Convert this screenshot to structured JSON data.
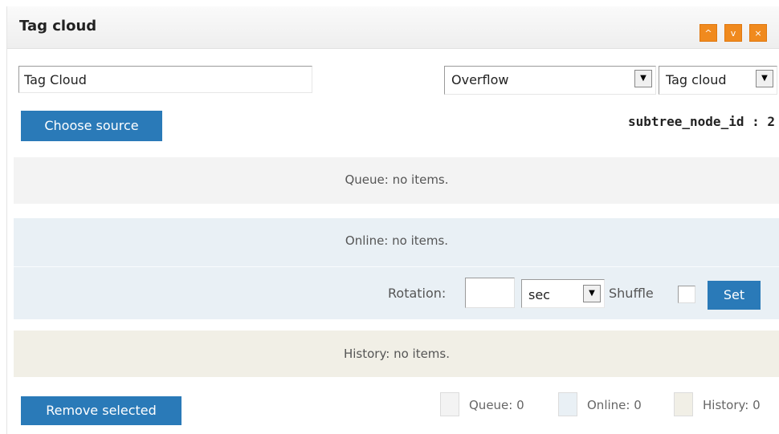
{
  "header": {
    "title": "Tag cloud",
    "buttons": [
      {
        "icon": "chevron-up-icon",
        "glyph": "^"
      },
      {
        "icon": "chevron-down-icon",
        "glyph": "v"
      },
      {
        "icon": "close-icon",
        "glyph": "×"
      }
    ],
    "button_color": "#f08a1e"
  },
  "form": {
    "name_value": "Tag Cloud",
    "overflow_select": "Overflow",
    "view_select": "Tag cloud",
    "choose_source_label": "Choose source",
    "subtree_label": "subtree_node_id : 2"
  },
  "queue": {
    "message": "Queue: no items.",
    "color": "#f3f3f3"
  },
  "online": {
    "message": "Online: no items.",
    "color": "#e9f0f5",
    "rotation_label": "Rotation:",
    "rotation_value": "",
    "unit_select": "sec",
    "shuffle_label": "Shuffle",
    "set_label": "Set"
  },
  "history": {
    "message": "History: no items.",
    "color": "#f1efe6"
  },
  "footer": {
    "remove_label": "Remove selected",
    "legend": [
      {
        "label": "Queue: 0",
        "color": "#f3f3f3"
      },
      {
        "label": "Online: 0",
        "color": "#e9f0f5"
      },
      {
        "label": "History: 0",
        "color": "#f1efe6"
      }
    ]
  },
  "accent_color": "#2a7ab8"
}
